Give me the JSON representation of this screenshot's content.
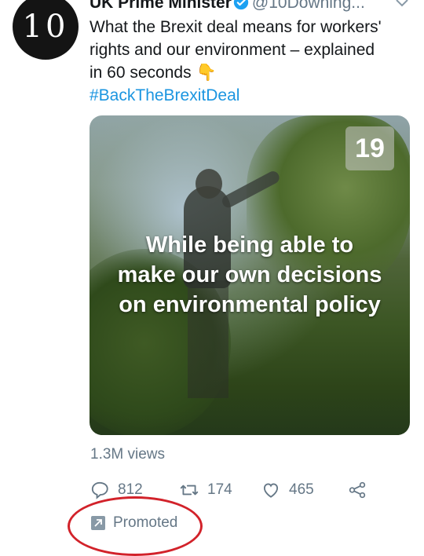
{
  "account": {
    "avatar_text": "10",
    "name": "UK Prime Minister",
    "handle": "@10Downing..."
  },
  "tweet": {
    "text_lines": [
      "What the Brexit deal means for workers'",
      "rights and our environment – explained",
      "in 60 seconds"
    ],
    "emoji": "👇",
    "hashtag": "#BackTheBrexitDeal"
  },
  "media": {
    "counter": "19",
    "caption_lines": [
      "While being able to",
      "make our own decisions",
      "on environmental policy"
    ]
  },
  "stats": {
    "views": "1.3M views"
  },
  "actions": {
    "replies": "812",
    "retweets": "174",
    "likes": "465"
  },
  "promoted_label": "Promoted",
  "colors": {
    "link": "#1b95e0",
    "muted": "#657786",
    "annotation": "#d2222a"
  },
  "icons": [
    "verified-badge-icon",
    "caret-down-icon",
    "reply-icon",
    "retweet-icon",
    "like-icon",
    "share-icon",
    "promoted-icon"
  ]
}
